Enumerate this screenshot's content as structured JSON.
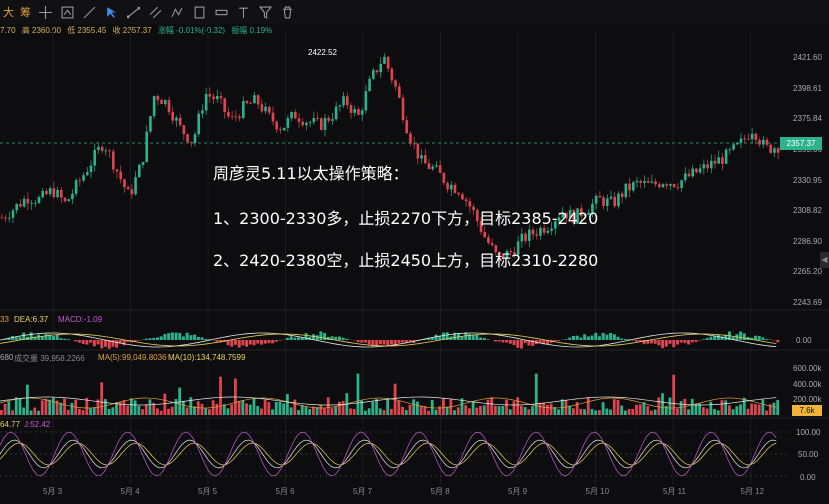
{
  "toolbar": {
    "labels": [
      "大",
      "筹"
    ]
  },
  "quote": {
    "open_fragment": "7.70",
    "high": "高 2360.00",
    "low": "低 2355.45",
    "close": "收 2357.37",
    "change": "涨幅 -0.01%(-0.32)",
    "amplitude": "振幅 0.19%"
  },
  "annotations": {
    "peak_label": "2422.52",
    "line1": "周彦灵5.11以太操作策略：",
    "line2": "1、2300-2330多，止损2270下方，目标2385-2420",
    "line3": "2、2420-2380空，止损2450上方，目标2310-2280"
  },
  "price_axis": [
    "2421.60",
    "2398.61",
    "2375.84",
    "2353.06",
    "2330.95",
    "2308.82",
    "2286.90",
    "2265.20",
    "2243.69"
  ],
  "current_price": "2357.37",
  "macd": {
    "label_a": "33",
    "label_b": "DEA:6.37",
    "label_c": "MACD:-1.09",
    "axis": "0.00"
  },
  "volume": {
    "label_a": "680",
    "label_b": "成交量 39,958.2266",
    "label_c": "MA(5):99,049.8036",
    "label_d": "MA(10):134,748.7599",
    "axis": [
      "600.00k",
      "400.00k",
      "200.00k"
    ],
    "current": "7.6k"
  },
  "kdj": {
    "label_a": "64.77",
    "label_b": "J:52.42",
    "axis": [
      "100.00",
      "50.00",
      "0.00"
    ]
  },
  "x_axis": [
    "5月 3",
    "5月 4",
    "5月 5",
    "5月 6",
    "5月 7",
    "5月 8",
    "5月 9",
    "5月 10",
    "5月 11",
    "5月 12"
  ],
  "colors": {
    "up": "#2bb38b",
    "down": "#e0454f",
    "accent": "#e0a13a",
    "text_overlay": "#ffffff"
  },
  "chart_data": {
    "type": "candlestick",
    "x_categories": [
      "5月 3",
      "5月 4",
      "5月 5",
      "5月 6",
      "5月 7",
      "5月 8",
      "5月 9",
      "5月 10",
      "5月 11",
      "5月 12"
    ],
    "price_series": [
      2305,
      2312,
      2320,
      2318,
      2325,
      2315,
      2330,
      2345,
      2360,
      2340,
      2320,
      2345,
      2395,
      2388,
      2370,
      2360,
      2395,
      2390,
      2375,
      2385,
      2390,
      2378,
      2370,
      2380,
      2375,
      2372,
      2380,
      2390,
      2378,
      2405,
      2422,
      2398,
      2365,
      2345,
      2340,
      2330,
      2325,
      2310,
      2290,
      2275,
      2280,
      2290,
      2295,
      2300,
      2310,
      2305,
      2312,
      2318,
      2315,
      2325,
      2330,
      2328,
      2332,
      2330,
      2335,
      2340,
      2345,
      2350,
      2358,
      2370,
      2355,
      2357
    ],
    "ylim": [
      2243.69,
      2421.6
    ],
    "current_price": 2357.37,
    "peak": 2422.52
  }
}
